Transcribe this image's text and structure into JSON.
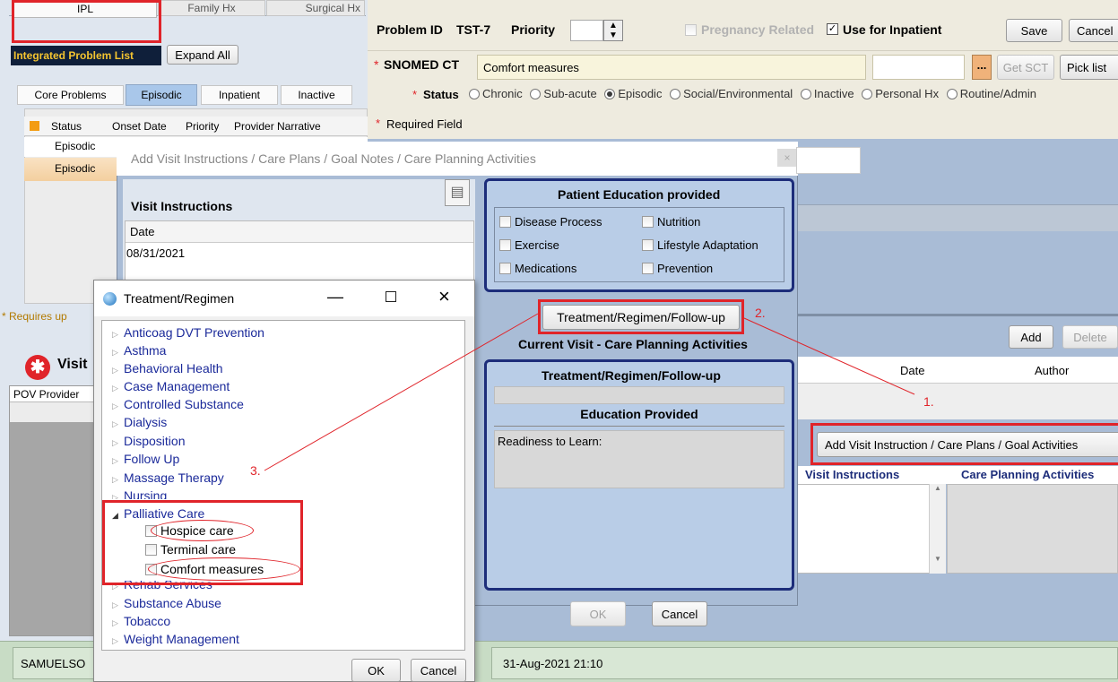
{
  "top_tabs": [
    {
      "label": "IPL"
    },
    {
      "label": "Family Hx"
    },
    {
      "label": "Surgical Hx"
    }
  ],
  "problem": {
    "id_label": "Problem ID",
    "id_value": "TST-7",
    "priority_label": "Priority",
    "pregnancy_label": "Pregnancy Related",
    "inpatient_label": "Use for Inpatient",
    "save": "Save",
    "cancel": "Cancel",
    "snomed_label": "SNOMED CT",
    "snomed_value": "Comfort measures",
    "ellipsis": "...",
    "get_sct": "Get SCT",
    "pick_list": "Pick list",
    "status_label": "Status",
    "status_options": [
      "Chronic",
      "Sub-acute",
      "Episodic",
      "Social/Environmental",
      "Inactive",
      "Personal Hx",
      "Routine/Admin"
    ],
    "status_selected": "Episodic",
    "required_note": "Required Field"
  },
  "ipl": {
    "title": "Integrated Problem List",
    "expand_all": "Expand All",
    "tabs": [
      "Core Problems",
      "Episodic",
      "Inpatient",
      "Inactive"
    ],
    "columns": [
      "Status",
      "Onset Date",
      "Priority",
      "Provider Narrative"
    ],
    "rows": [
      "Episodic",
      "Episodic"
    ],
    "requires_note": "* Requires up",
    "visit_label": "Visit",
    "pov_provider": "POV Provider"
  },
  "dialog": {
    "title": "Add Visit Instructions / Care Plans / Goal Notes / Care Planning Activities",
    "visit_instructions": "Visit Instructions",
    "date_header": "Date",
    "date_value": "08/31/2021",
    "patient_ed_title": "Patient Education provided",
    "patient_ed_items": [
      "Disease Process",
      "Nutrition",
      "Exercise",
      "Lifestyle Adaptation",
      "Medications",
      "Prevention"
    ],
    "treatment_button": "Treatment/Regimen/Follow-up",
    "current_visit_title": "Current Visit - Care Planning Activities",
    "treatment_header": "Treatment/Regimen/Follow-up",
    "education_header": "Education Provided",
    "readiness": "Readiness to Learn:",
    "ok": "OK",
    "cancel": "Cancel"
  },
  "treatment_window": {
    "title": "Treatment/Regimen",
    "items": [
      "Anticoag DVT Prevention",
      "Asthma",
      "Behavioral Health",
      "Case Management",
      "Controlled Substance",
      "Dialysis",
      "Disposition",
      "Follow Up",
      "Massage Therapy",
      "Nursing",
      "Palliative Care",
      "Rehab Services",
      "Substance Abuse",
      "Tobacco",
      "Weight Management"
    ],
    "palliative_children": [
      "Hospice care",
      "Terminal care",
      "Comfort measures"
    ],
    "ok": "OK",
    "cancel": "Cancel"
  },
  "right_panel": {
    "add": "Add",
    "delete": "Delete",
    "date_col": "Date",
    "author_col": "Author",
    "add_visit_button": "Add Visit Instruction / Care Plans / Goal Activities",
    "visit_instructions_col": "Visit Instructions",
    "care_planning_col": "Care Planning Activities"
  },
  "status_bar": {
    "user": "SAMUELSO",
    "datetime": "31-Aug-2021 21:10"
  },
  "annotations": {
    "n1": "1.",
    "n2": "2.",
    "n3": "3."
  },
  "colors": {
    "annotation_red": "#e0242a",
    "group_border": "#1d2d7a",
    "ipl_title": "#f4c430"
  }
}
